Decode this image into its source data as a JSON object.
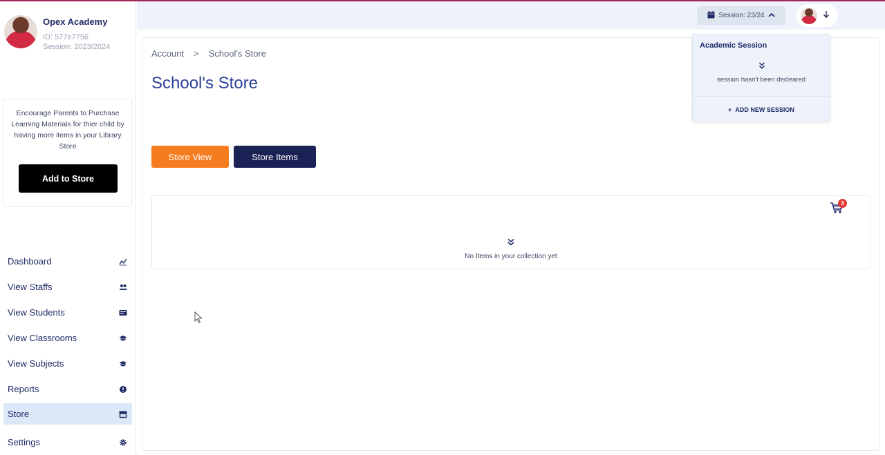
{
  "profile": {
    "name": "Opex Academy",
    "id": "ID: 577e7756",
    "session": "Session: 2023/2024"
  },
  "promo": {
    "text": "Encourage Parents to Purchase Learning Materials for thier child by having more items in your Library Store",
    "button": "Add to Store"
  },
  "nav": {
    "items": [
      {
        "label": "Dashboard",
        "icon": "chart-line-icon"
      },
      {
        "label": "View Staffs",
        "icon": "users-icon"
      },
      {
        "label": "View Students",
        "icon": "id-card-icon"
      },
      {
        "label": "View Classrooms",
        "icon": "graduation-cap-icon"
      },
      {
        "label": "View Subjects",
        "icon": "graduation-cap-icon"
      },
      {
        "label": "Reports",
        "icon": "info-circle-icon"
      },
      {
        "label": "Store",
        "icon": "store-icon"
      },
      {
        "label": "Settings",
        "icon": "gear-icon"
      }
    ],
    "active": "Store"
  },
  "topbar": {
    "session": "Session: 23/24"
  },
  "dropdown": {
    "title": "Academic Session",
    "message": "session hasn't been decleared",
    "add": "ADD NEW SESSION"
  },
  "breadcrumb": {
    "root": "Account",
    "separator": ">",
    "current": "School's Store"
  },
  "page": {
    "title": "School's Store",
    "store_view": "Store View",
    "store_items": "Store Items"
  },
  "collection": {
    "cart_count": "3",
    "empty_text": "No Items in your collection yet"
  },
  "colors": {
    "accent_orange": "#f57c1f",
    "navy": "#1b2255",
    "title_blue": "#2a3f9a",
    "active_nav": "#dbe8f8",
    "badge_red": "#e53935"
  }
}
